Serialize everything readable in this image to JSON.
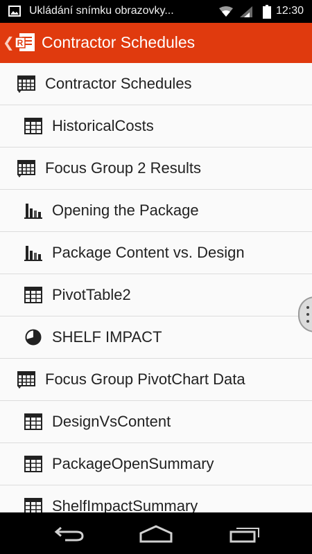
{
  "status_bar": {
    "notification_text": "Ukládání snímku obrazovky...",
    "time": "12:30",
    "icons": [
      "image-notification-icon",
      "wifi-icon",
      "signal-icon",
      "battery-icon"
    ]
  },
  "app_bar": {
    "title": "Contractor Schedules",
    "brand_color": "#e03a0e",
    "logo": "office-document-logo"
  },
  "list": {
    "items": [
      {
        "label": "Contractor Schedules",
        "icon": "worksheet-icon",
        "level": 0
      },
      {
        "label": "HistoricalCosts",
        "icon": "table-icon",
        "level": 1
      },
      {
        "label": "Focus Group 2 Results",
        "icon": "worksheet-icon",
        "level": 0
      },
      {
        "label": "Opening the Package",
        "icon": "bar-chart-icon",
        "level": 1
      },
      {
        "label": "Package Content vs. Design",
        "icon": "bar-chart-icon",
        "level": 1
      },
      {
        "label": "PivotTable2",
        "icon": "table-icon",
        "level": 1
      },
      {
        "label": "SHELF IMPACT",
        "icon": "pie-chart-icon",
        "level": 1
      },
      {
        "label": "Focus Group PivotChart Data",
        "icon": "worksheet-icon",
        "level": 0
      },
      {
        "label": "DesignVsContent",
        "icon": "table-icon",
        "level": 1
      },
      {
        "label": "PackageOpenSummary",
        "icon": "table-icon",
        "level": 1
      },
      {
        "label": "ShelfImpactSummary",
        "icon": "table-icon",
        "level": 1
      }
    ]
  },
  "nav_bar": {
    "buttons": [
      "back-icon",
      "home-icon",
      "recent-apps-icon"
    ]
  }
}
